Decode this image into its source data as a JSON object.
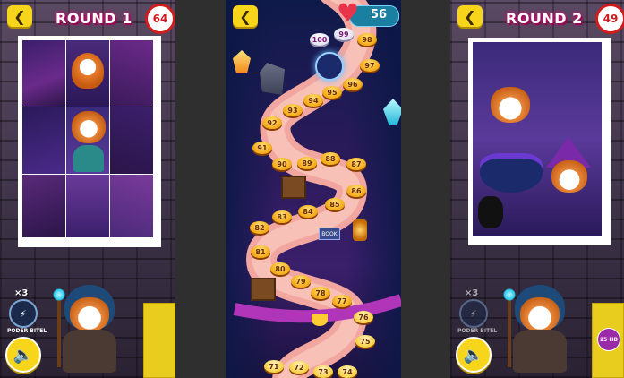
{
  "left": {
    "round_title": "ROUND 1",
    "counter": "64",
    "power_multiplier": "×3",
    "power_label": "PODER BITEL"
  },
  "middle": {
    "lives": "56",
    "levels": [
      "100",
      "99",
      "98",
      "97",
      "96",
      "95",
      "94",
      "93",
      "92",
      "91",
      "90",
      "89",
      "88",
      "87",
      "86",
      "85",
      "84",
      "83",
      "82",
      "81",
      "80",
      "79",
      "78",
      "77",
      "76",
      "75",
      "74",
      "73",
      "72",
      "71"
    ],
    "sign_text": "BOOK"
  },
  "right": {
    "round_title": "ROUND 2",
    "counter": "49",
    "power_multiplier": "×3",
    "power_label": "PODER BITEL",
    "badge": "25 HB"
  },
  "colors": {
    "accent_yellow": "#f7d51a",
    "counter_red": "#d21b1b",
    "title_glow": "#c0136f",
    "node_orange": "#f3a712"
  }
}
